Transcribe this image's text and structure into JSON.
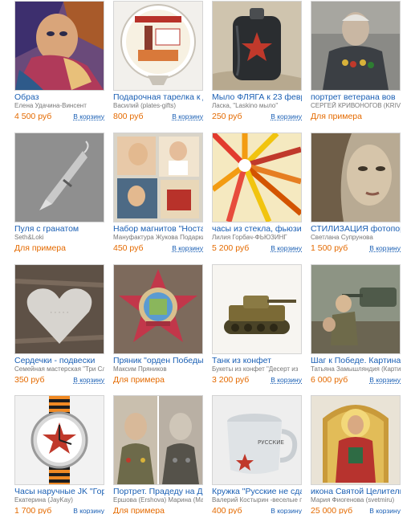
{
  "products": [
    {
      "title": "Образ",
      "author": "Елена Удачина-Винсент",
      "price": "4 500 руб",
      "cart": "В корзину",
      "image": "abstract-portrait-painting"
    },
    {
      "title": "Подарочная тарелка к дню",
      "author": "Василий (plates-gifts)",
      "price": "800 руб",
      "cart": "В корзину",
      "image": "commemorative-plate"
    },
    {
      "title": "Мыло ФЛЯГА к 23 февраля",
      "author": "Ласка, \"Laskino мыло\"",
      "price": "250 руб",
      "cart": "В корзину",
      "image": "soap-flask"
    },
    {
      "title": "портрет ветерана вов",
      "author": "СЕРГЕЙ КРИВОНОГОВ (KRIVON",
      "price": "Для примера",
      "cart": "",
      "image": "veteran-portrait"
    },
    {
      "title": "Пуля с гранатом",
      "author": "Seth&Loki",
      "price": "Для примера",
      "cart": "",
      "image": "bullet-pendant"
    },
    {
      "title": "Набор магнитов \"Ностальг",
      "author": "Мануфактура Жукова Подарки",
      "price": "450 руб",
      "cart": "В корзину",
      "image": "magnet-set"
    },
    {
      "title": "часы из стекла, фьюзинг Г",
      "author": "Лилия Горбач-ФЬЮЗИНГ",
      "price": "5 200 руб",
      "cart": "В корзину",
      "image": "fused-glass-clock"
    },
    {
      "title": "СТИЛИЗАЦИЯ фотопортрет",
      "author": "Светлана Супрунова",
      "price": "1 500 руб",
      "cart": "В корзину",
      "image": "stylized-photo-portrait"
    },
    {
      "title": "Сердечки - подвески",
      "author": "Семейная мастерская \"Три Сл",
      "price": "350 руб",
      "cart": "В корзину",
      "image": "heart-pendants"
    },
    {
      "title": "Пряник \"орден Победы\"",
      "author": "Максим Пряников",
      "price": "Для примера",
      "cart": "",
      "image": "victory-order-gingerbread"
    },
    {
      "title": "Танк из конфет",
      "author": "Букеты из конфет \"Десерт из",
      "price": "3 200 руб",
      "cart": "В корзину",
      "image": "candy-tank"
    },
    {
      "title": "Шаг к Победе. Картина про",
      "author": "Татьяна Замышляндия (Картин",
      "price": "6 000 руб",
      "cart": "В корзину",
      "image": "war-painting"
    },
    {
      "title": "Часы наручные JK \"Гордос",
      "author": "Екатерина (JayKay)",
      "price": "1 700 руб",
      "cart": "В корзину",
      "image": "wristwatch"
    },
    {
      "title": "Портрет. Прадеду на День",
      "author": "Ершова (Ershova) Марина (Ма",
      "price": "Для примера",
      "cart": "",
      "image": "great-grandfather-portraits"
    },
    {
      "title": "Кружка \"Русские не сдаютс",
      "author": "Валерий Костырин -веселые п",
      "price": "400 руб",
      "cart": "В корзину",
      "image": "aluminum-mug"
    },
    {
      "title": "икона Святой Целитель Па",
      "author": "Мария Фиогенова (svetmiru)",
      "price": "25 000 руб",
      "cart": "В корзину",
      "image": "saint-icon"
    }
  ],
  "colors": {
    "link": "#1a5fb4",
    "price": "#e46a00",
    "muted": "#777777"
  }
}
